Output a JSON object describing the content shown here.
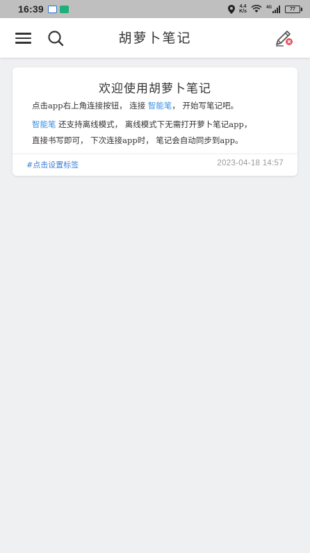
{
  "status_bar": {
    "time": "16:39",
    "net_speed_value": "4.4",
    "net_speed_unit": "K/s",
    "network_type": "4G",
    "battery": "77"
  },
  "app_bar": {
    "title": "胡萝卜笔记",
    "icons": [
      "menu-icon",
      "search-icon",
      "pen-icon"
    ]
  },
  "note": {
    "title": "欢迎使用胡萝卜笔记",
    "line1_pre": "点击app右上角连接按钮，  连接 ",
    "line1_hl": "智能笔",
    "line1_post": "，  开始写笔记吧。",
    "line2_hl": "智能笔",
    "line2_post": " 还支持离线模式，  离线模式下无需打开萝卜笔记app，",
    "line3": "直接书写即可，  下次连接app时，  笔记会自动同步到app。",
    "tag": "#点击设置标签",
    "date": "2023-04-18 14:57"
  },
  "colors": {
    "accent": "#3b8fe0",
    "tag": "#3b7fd6",
    "date": "#9a9a9a",
    "background": "#eff0f2",
    "pen_badge": "#e8505b"
  }
}
